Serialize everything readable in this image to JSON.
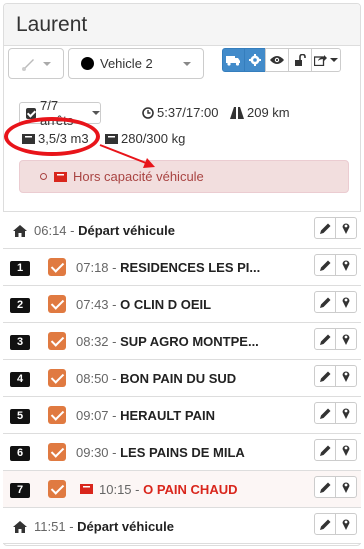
{
  "header": {
    "title": "Laurent"
  },
  "toolbar": {
    "vehicle_label": "Vehicle 2",
    "buttons": [
      "truck-icon",
      "gear-icon",
      "eye-icon",
      "unlock-icon",
      "share-icon"
    ]
  },
  "summary": {
    "stops": "7/7 arrêts",
    "time": "5:37/17:00",
    "distance": "209 km",
    "volume": "3,5/3 m3",
    "weight": "280/300 kg",
    "alert": "Hors capacité véhicule"
  },
  "route": {
    "start": {
      "time": "06:14",
      "label": "Départ véhicule"
    },
    "stops": [
      {
        "number": "1",
        "time": "07:18",
        "name": "RESIDENCES LES PI..."
      },
      {
        "number": "2",
        "time": "07:43",
        "name": "O CLIN D OEIL"
      },
      {
        "number": "3",
        "time": "08:32",
        "name": "SUP AGRO MONTPE..."
      },
      {
        "number": "4",
        "time": "08:50",
        "name": "BON PAIN DU SUD"
      },
      {
        "number": "5",
        "time": "09:07",
        "name": "HERAULT PAIN"
      },
      {
        "number": "6",
        "time": "09:30",
        "name": "LES PAINS DE MILA"
      },
      {
        "number": "7",
        "time": "10:15",
        "name": "O PAIN CHAUD"
      }
    ],
    "end": {
      "time": "11:51",
      "label": "Départ véhicule"
    }
  },
  "separator": " - ",
  "colors": {
    "accent": "#428bca",
    "danger": "#d9261c",
    "checkbox": "#e07a41",
    "annotation": "#e8141a"
  }
}
